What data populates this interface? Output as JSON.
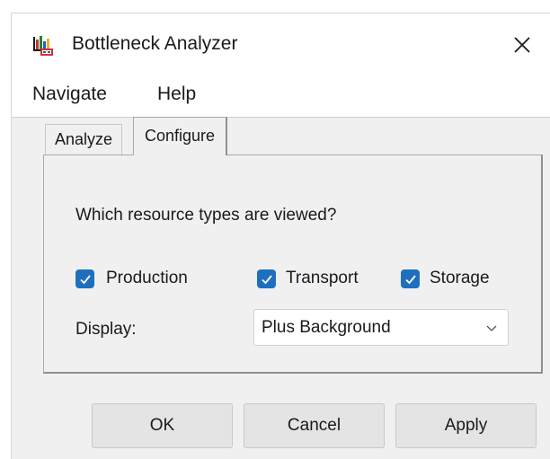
{
  "window": {
    "title": "Bottleneck Analyzer",
    "app_icon": "bar-chart-app-icon",
    "close_icon": "close-icon"
  },
  "menu": {
    "items": [
      "Navigate",
      "Help"
    ]
  },
  "tabs": [
    "Analyze",
    "Configure"
  ],
  "configure": {
    "question": "Which resource types are viewed?",
    "checkboxes": [
      {
        "label": "Production",
        "checked": true
      },
      {
        "label": "Transport",
        "checked": true
      },
      {
        "label": "Storage",
        "checked": true
      }
    ],
    "display_label": "Display:",
    "display_value": "Plus Background"
  },
  "buttons": {
    "ok": "OK",
    "cancel": "Cancel",
    "apply": "Apply"
  },
  "colors": {
    "checkbox_accent": "#1f6fbf",
    "window_bg": "#f0f0f0",
    "titlebar_bg": "#ffffff"
  }
}
